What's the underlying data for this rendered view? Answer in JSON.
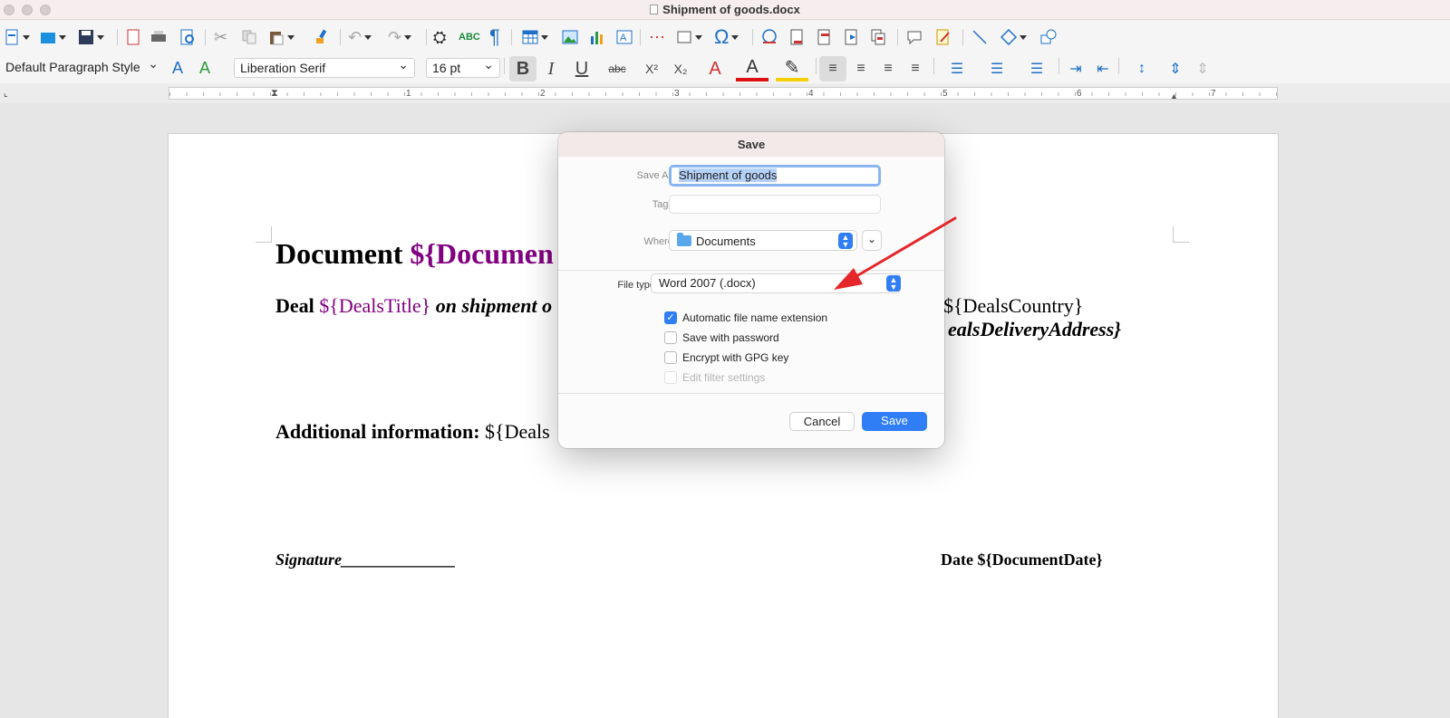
{
  "window": {
    "title": "Shipment of goods.docx"
  },
  "toolbar": {
    "paragraph_style": "Default Paragraph Style",
    "font_name": "Liberation Serif",
    "font_size": "16 pt",
    "bold": "B",
    "italic": "I",
    "underline": "U",
    "strikethrough": "abc",
    "superscript": "X²",
    "subscript": "X₂",
    "spelling": "ABC",
    "formatting_marks": "¶",
    "special_char": "Ω"
  },
  "ruler": {
    "numbers": [
      "1",
      "2",
      "3",
      "4",
      "5",
      "6",
      "7"
    ]
  },
  "document": {
    "heading_prefix": "Document ",
    "heading_var": "${Documen",
    "deal_label": "Deal ",
    "deal_var": "${DealsTitle}",
    "deal_italic": " on shipment o",
    "country_var": "${DealsCountry}",
    "address_fragment": "ealsDeliveryAddress}",
    "additional_label": "Additional information:",
    "additional_var": " ${Deals",
    "signature_label": "Signature",
    "signature_line": "______________",
    "date_text": "Date ${DocumentDate}"
  },
  "dialog": {
    "title": "Save",
    "save_as_label": "Save As:",
    "save_as_value": "Shipment of goods",
    "tags_label": "Tags:",
    "tags_value": "",
    "where_label": "Where:",
    "where_value": "Documents",
    "file_type_label": "File type:",
    "file_type_value": "Word 2007 (.docx)",
    "options": [
      {
        "label": "Automatic file name extension",
        "checked": true,
        "enabled": true
      },
      {
        "label": "Save with password",
        "checked": false,
        "enabled": true
      },
      {
        "label": "Encrypt with GPG key",
        "checked": false,
        "enabled": true
      },
      {
        "label": "Edit filter settings",
        "checked": false,
        "enabled": false
      }
    ],
    "cancel_label": "Cancel",
    "save_label": "Save"
  },
  "colors": {
    "accent": "#2f7ef5",
    "variable": "#800080",
    "annotation_arrow": "#e5262a"
  }
}
